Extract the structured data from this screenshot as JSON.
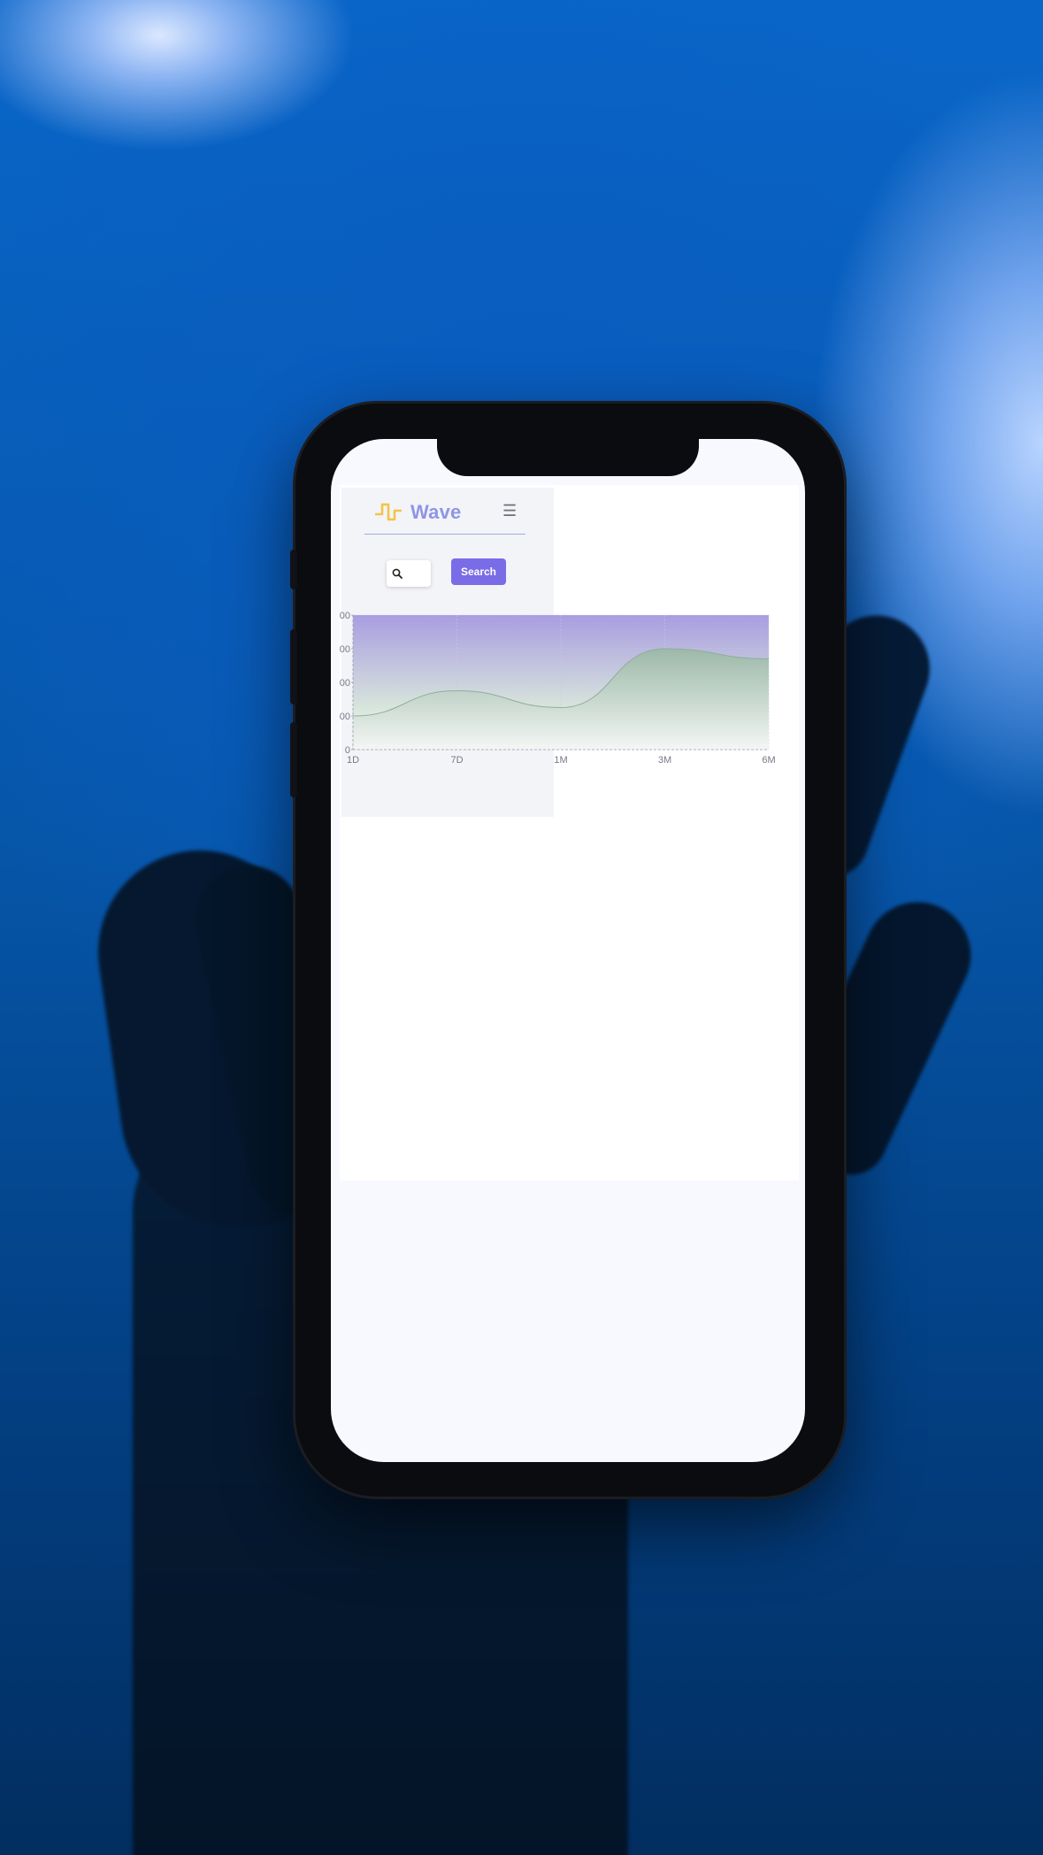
{
  "app": {
    "name": "Wave",
    "brand_icon": "pulse-wave-icon",
    "menu_icon": "hamburger-menu-icon"
  },
  "search": {
    "placeholder": "",
    "button_label": "Search",
    "icon": "search-icon"
  },
  "colors": {
    "accent": "#7a6be6",
    "brand_text": "#8e96e3",
    "brand_icon": "#f3c44a",
    "chart_top": "#a99de0",
    "chart_fill": "#9bb8a6"
  },
  "chart_data": {
    "type": "area",
    "categories": [
      "1D",
      "7D",
      "1M",
      "3M",
      "6M"
    ],
    "x": [
      0,
      1,
      2,
      3,
      4
    ],
    "series": [
      {
        "values": [
          100,
          175,
          125,
          300,
          270
        ]
      }
    ],
    "ylim": [
      0,
      400
    ],
    "y_ticks": [
      0,
      100,
      200,
      300,
      400
    ],
    "y_tick_labels": [
      "0",
      "00",
      "00",
      "00",
      "00"
    ],
    "grid": true,
    "legend": "none"
  }
}
